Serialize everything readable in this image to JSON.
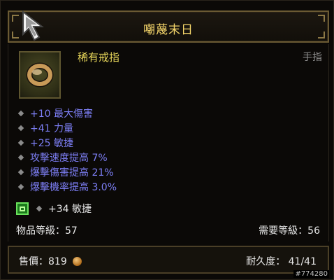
{
  "header": {
    "title": "嘲蔑末日"
  },
  "item": {
    "name": "稀有戒指",
    "slot": "手指",
    "icon": "ring-icon"
  },
  "stats": [
    "+10 最大傷害",
    "+41 力量",
    "+25 敏捷",
    "攻擊速度提高 7%",
    "爆擊傷害提高 21%",
    "爆擊機率提高 3.0%"
  ],
  "socket": {
    "gem_icon": "emerald-gem-icon",
    "text": "+34 敏捷"
  },
  "levels": {
    "item_level": "物品等級：57",
    "required_level": "需要等級：56"
  },
  "footer": {
    "price": "售價：819",
    "durability": "耐久度： 41/41"
  },
  "watermark": "#774280",
  "colors": {
    "title": "#f4d56a",
    "item_name": "#e7d65a",
    "affix": "#7d7ff6",
    "gem": "#1b7a1c"
  }
}
